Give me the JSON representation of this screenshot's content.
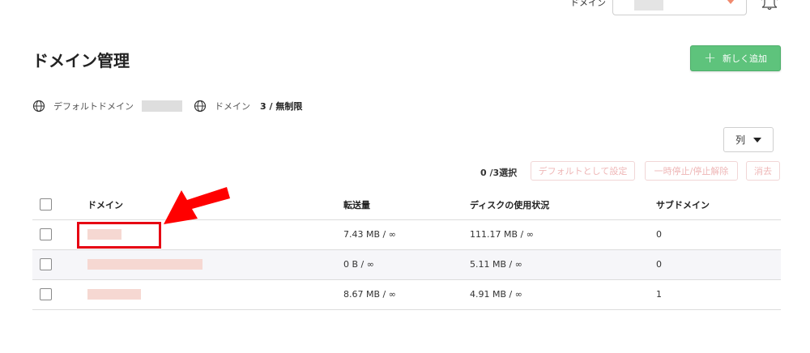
{
  "header": {
    "domain_selector_label": "ドメイン",
    "bell_icon": "bell-icon"
  },
  "page": {
    "title": "ドメイン管理",
    "add_button_label": "新しく追加"
  },
  "info": {
    "default_domain_label": "デフォルトドメイン",
    "domain_label": "ドメイン",
    "domain_count": "3 / 無制限",
    "icon": "globe-icon"
  },
  "toolbar": {
    "columns_label": "列",
    "selected_count": "0 /3選択",
    "set_default_label": "デフォルトとして設定",
    "pause_label": "一時停止/停止解除",
    "delete_label": "消去"
  },
  "table": {
    "headers": [
      "ドメイン",
      "転送量",
      "ディスクの使用状況",
      "サブドメイン"
    ],
    "rows": [
      {
        "transfer": "7.43 MB / ∞",
        "disk": "111.17 MB / ∞",
        "subdomains": "0"
      },
      {
        "transfer": "0 B / ∞",
        "disk": "5.11 MB / ∞",
        "subdomains": "0"
      },
      {
        "transfer": "8.67 MB / ∞",
        "disk": "4.91 MB / ∞",
        "subdomains": "1"
      }
    ]
  },
  "colors": {
    "accent_green": "#5ec37c",
    "highlight_red": "#e60012",
    "disabled_text": "#efb7b7"
  }
}
